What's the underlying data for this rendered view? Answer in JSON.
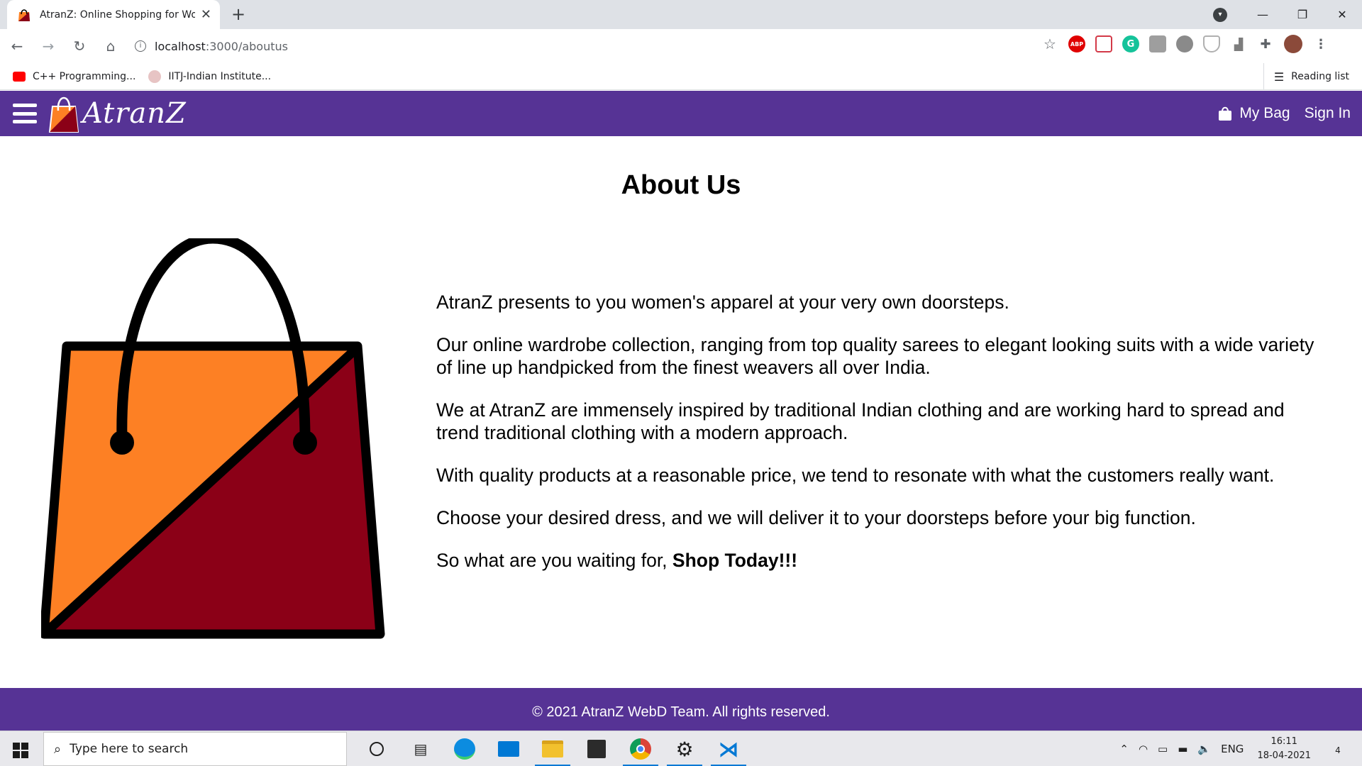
{
  "browser": {
    "tab_title": "AtranZ: Online Shopping for Wor",
    "tab_close": "✕",
    "new_tab": "+",
    "url_host": "localhost",
    "url_path": ":3000/aboutus",
    "bookmarks": [
      {
        "label": "C++ Programming...",
        "color": "#ff0000"
      },
      {
        "label": "IITJ-Indian Institute...",
        "color": "#d9a0a0"
      }
    ],
    "reading_list": "Reading list",
    "extensions": [
      {
        "name": "adblock",
        "text": "ABP",
        "color": "#e00000"
      },
      {
        "name": "pocket",
        "text": "",
        "color": "#d33a48"
      },
      {
        "name": "grammarly",
        "text": "G",
        "color": "#15c39a"
      },
      {
        "name": "extension-gray",
        "text": "",
        "color": "#9e9e9e"
      },
      {
        "name": "cloud",
        "text": "",
        "color": "#8a8a8a"
      },
      {
        "name": "shield",
        "text": "",
        "color": "#b0b0b0"
      },
      {
        "name": "chart",
        "text": "",
        "color": "#7d7d7d"
      },
      {
        "name": "puzzle",
        "text": "",
        "color": "#5f6368"
      }
    ]
  },
  "header": {
    "logo_text": "AtranZ",
    "my_bag": "My Bag",
    "sign_in": "Sign In"
  },
  "main": {
    "title": "About Us",
    "paragraphs": [
      "AtranZ presents to you women's apparel at your very own doorsteps.",
      "Our online wardrobe collection, ranging from top quality sarees to elegant looking suits with a wide variety of line up handpicked from the finest weavers all over India.",
      "We at AtranZ are immensely inspired by traditional Indian clothing and are working hard to spread and trend traditional clothing with a modern approach.",
      "With quality products at a reasonable price, we tend to resonate with what the customers really want.",
      "Choose your desired dress, and we will deliver it to your doorsteps before your big function."
    ],
    "closing_lead": "So what are you waiting for, ",
    "closing_strong": "Shop Today!!!"
  },
  "footer": {
    "text": "© 2021 AtranZ WebD Team. All rights reserved."
  },
  "taskbar": {
    "search_placeholder": "Type here to search",
    "language": "ENG",
    "time": "16:11",
    "date": "18-04-2021",
    "notifications": "4"
  },
  "colors": {
    "brand_purple": "#563395",
    "bag_orange": "#fd8024",
    "bag_maroon": "#8b0017"
  }
}
